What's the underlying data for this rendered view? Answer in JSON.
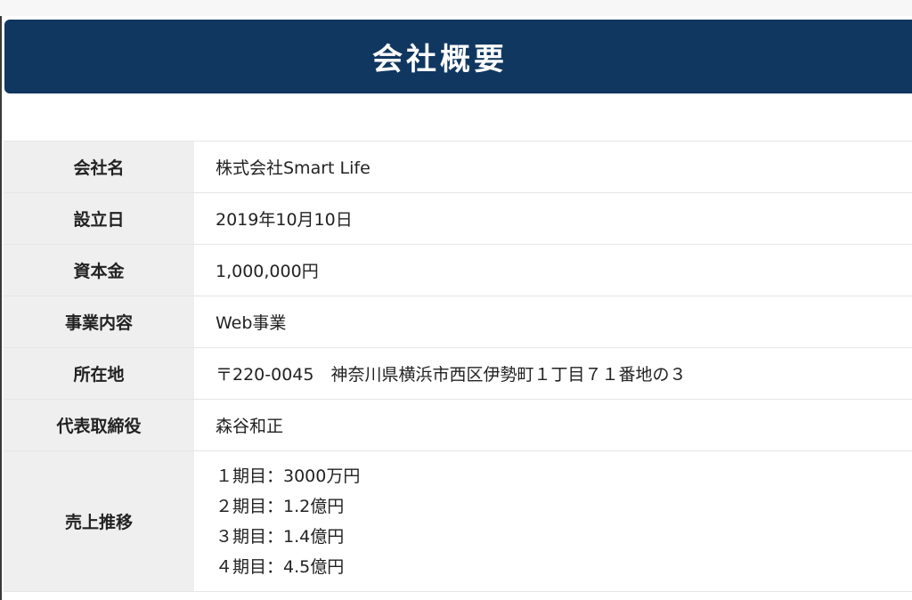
{
  "header": {
    "title": "会社概要"
  },
  "company": {
    "rows": [
      {
        "label": "会社名",
        "value": "株式会社Smart Life"
      },
      {
        "label": "設立日",
        "value": "2019年10月10日"
      },
      {
        "label": "資本金",
        "value": "1,000,000円"
      },
      {
        "label": "事業内容",
        "value": "Web事業"
      },
      {
        "label": "所在地",
        "value": "〒220-0045　神奈川県横浜市西区伊勢町１丁目７１番地の３"
      },
      {
        "label": "代表取締役",
        "value": "森谷和正"
      }
    ],
    "sales": {
      "label": "売上推移",
      "items": [
        "１期目：3000万円",
        "２期目：1.2億円",
        "３期目：1.4億円",
        "４期目：4.5億円"
      ]
    }
  },
  "colors": {
    "header_bg": "#103760",
    "label_bg": "#efefef"
  }
}
